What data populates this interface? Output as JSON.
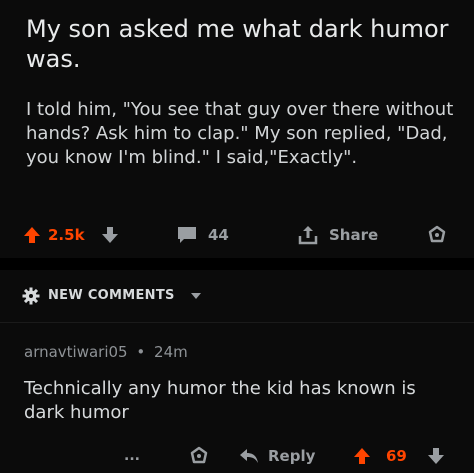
{
  "post": {
    "title": "My son asked me what dark humor was.",
    "body": "I told him, \"You see that guy over there without hands? Ask him to clap.\" My son replied, \"Dad, you know I'm blind.\" I said,\"Exactly\".",
    "upvotes": "2.5k",
    "comments": "44",
    "share_label": "Share"
  },
  "new_comments": {
    "label": "NEW COMMENTS"
  },
  "comment": {
    "author": "arnavtiwari05",
    "separator": "•",
    "age": "24m",
    "body": "Technically any humor the kid has known is dark humor",
    "more": "...",
    "reply_label": "Reply",
    "score": "69"
  },
  "colors": {
    "upvote": "#ff4500",
    "background": "#0b0b0b",
    "text": "#d7dadc",
    "muted": "#8e9296"
  },
  "icons": [
    "upvote-icon",
    "downvote-icon",
    "comment-icon",
    "share-icon",
    "award-icon",
    "gear-icon",
    "chevron-down-icon",
    "reply-icon",
    "more-icon"
  ]
}
